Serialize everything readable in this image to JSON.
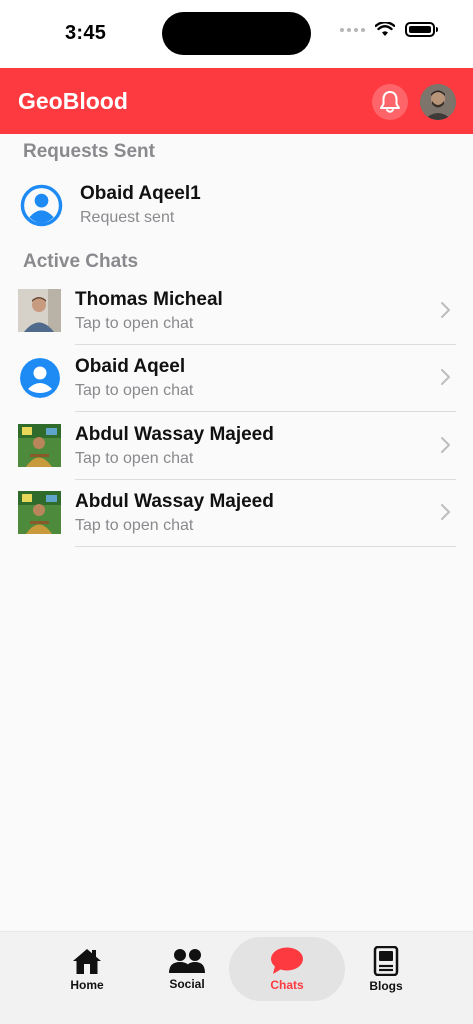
{
  "status_bar": {
    "time": "3:45"
  },
  "header": {
    "title": "GeoBlood",
    "brand_color": "#fd3a40"
  },
  "sections": {
    "requests_title": "Requests Sent",
    "chats_title": "Active Chats"
  },
  "requests": [
    {
      "name": "Obaid Aqeel1",
      "status": "Request sent",
      "avatar": "default-user-icon"
    }
  ],
  "chats": [
    {
      "name": "Thomas Micheal",
      "subtitle": "Tap to open chat",
      "avatar": "photo"
    },
    {
      "name": "Obaid Aqeel",
      "subtitle": "Tap to open chat",
      "avatar": "default-user-icon"
    },
    {
      "name": "Abdul Wassay Majeed",
      "subtitle": "Tap to open chat",
      "avatar": "photo"
    },
    {
      "name": "Abdul Wassay Majeed",
      "subtitle": "Tap to open chat",
      "avatar": "photo"
    }
  ],
  "tabs": [
    {
      "label": "Home",
      "icon": "home-icon"
    },
    {
      "label": "Social",
      "icon": "people-icon"
    },
    {
      "label": "Chats",
      "icon": "chat-bubble-icon",
      "active": true
    },
    {
      "label": "Blogs",
      "icon": "book-icon"
    }
  ]
}
